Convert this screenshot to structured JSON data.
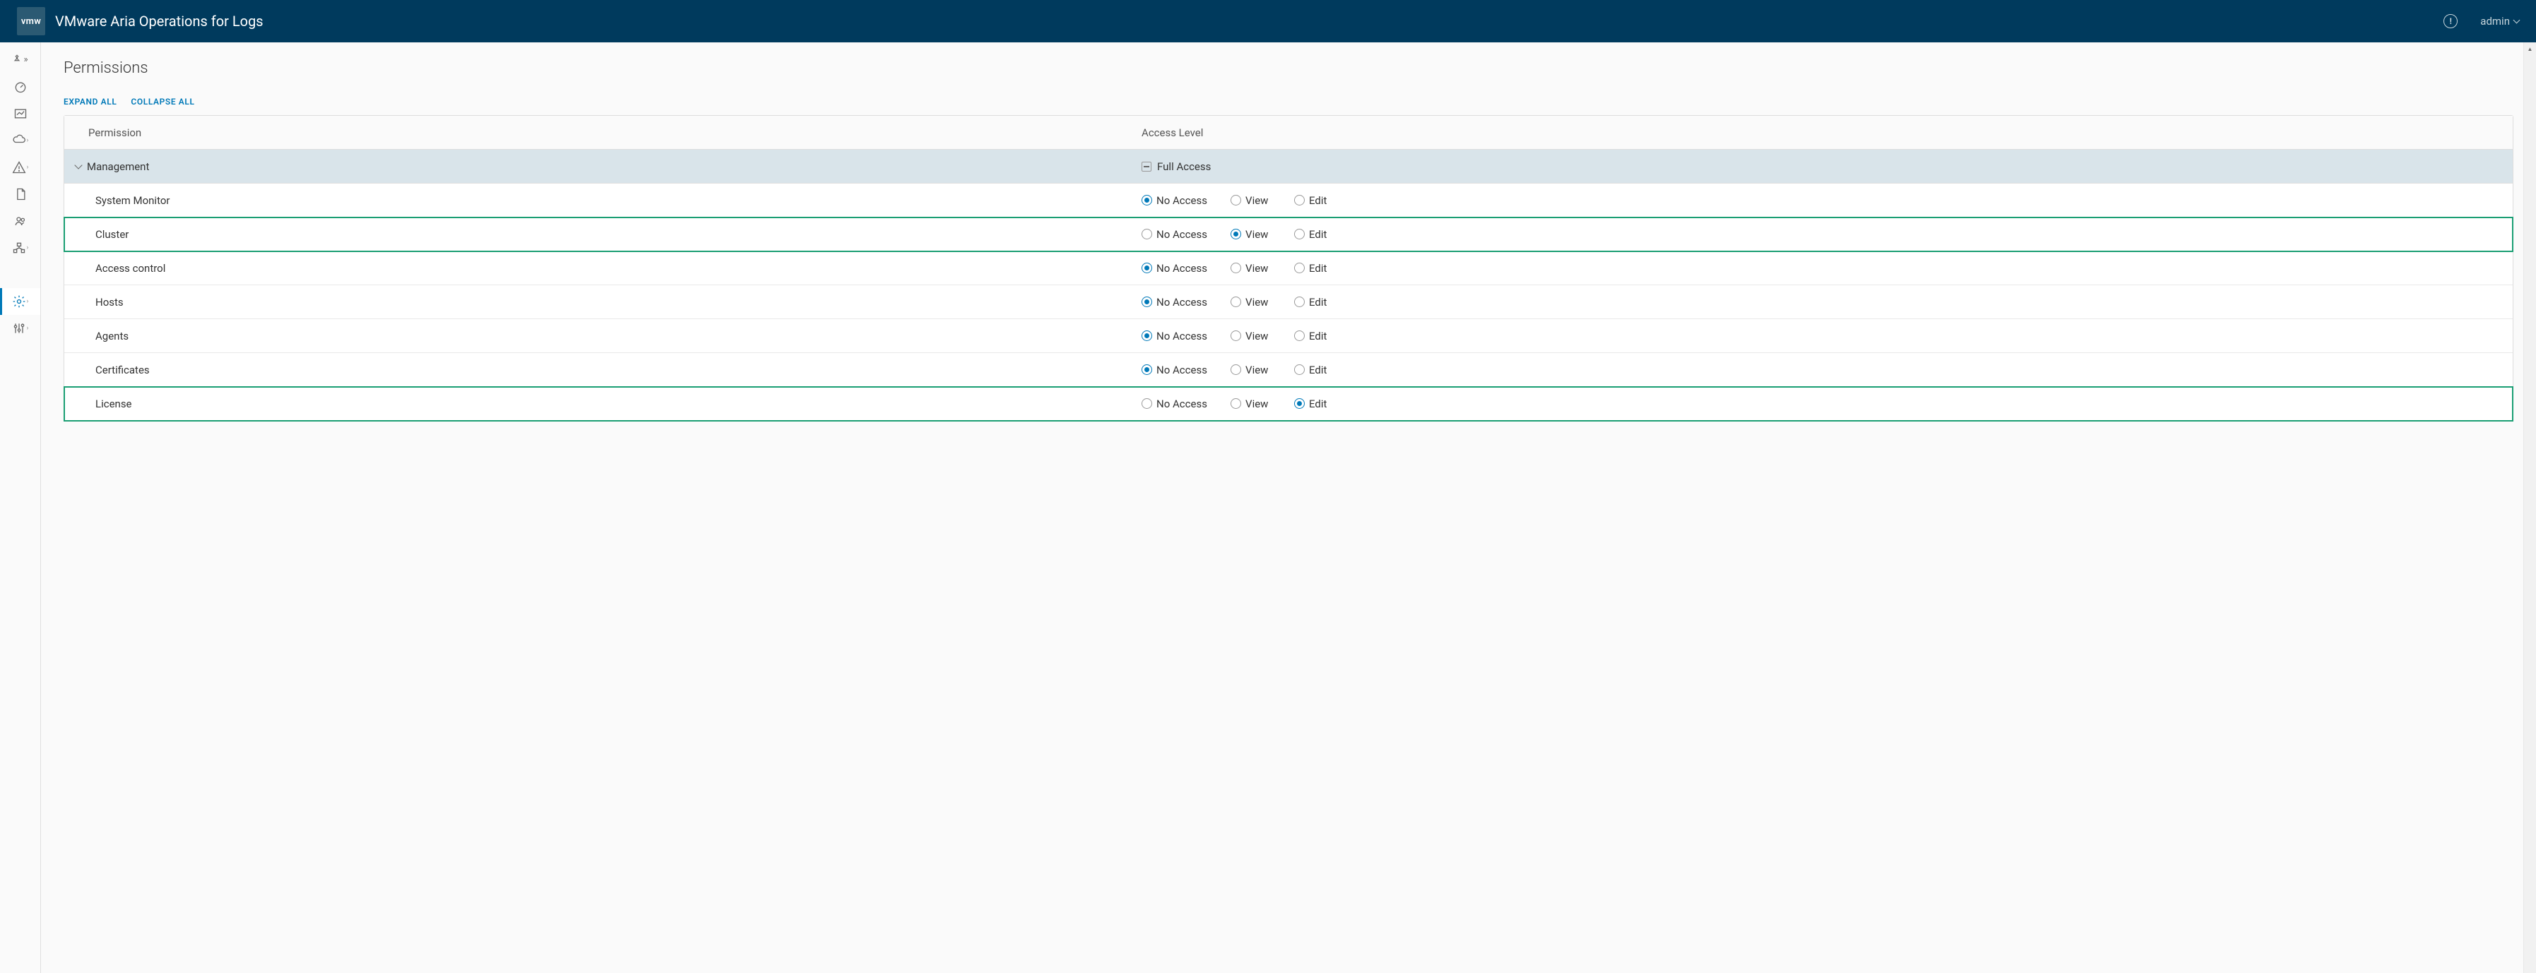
{
  "header": {
    "logo_text": "vmw",
    "product_title": "VMware Aria Operations for Logs",
    "user": "admin"
  },
  "page": {
    "title": "Permissions",
    "expand_all": "EXPAND ALL",
    "collapse_all": "COLLAPSE ALL"
  },
  "table": {
    "col_permission": "Permission",
    "col_access": "Access Level",
    "group_name": "Management",
    "group_access": "Full Access"
  },
  "access_labels": {
    "no_access": "No Access",
    "view": "View",
    "edit": "Edit"
  },
  "rows": [
    {
      "label": "System Monitor",
      "selected": "no_access",
      "highlighted": false
    },
    {
      "label": "Cluster",
      "selected": "view",
      "highlighted": true
    },
    {
      "label": "Access control",
      "selected": "no_access",
      "highlighted": false
    },
    {
      "label": "Hosts",
      "selected": "no_access",
      "highlighted": false
    },
    {
      "label": "Agents",
      "selected": "no_access",
      "highlighted": false
    },
    {
      "label": "Certificates",
      "selected": "no_access",
      "highlighted": false
    },
    {
      "label": "License",
      "selected": "edit",
      "highlighted": true
    }
  ]
}
